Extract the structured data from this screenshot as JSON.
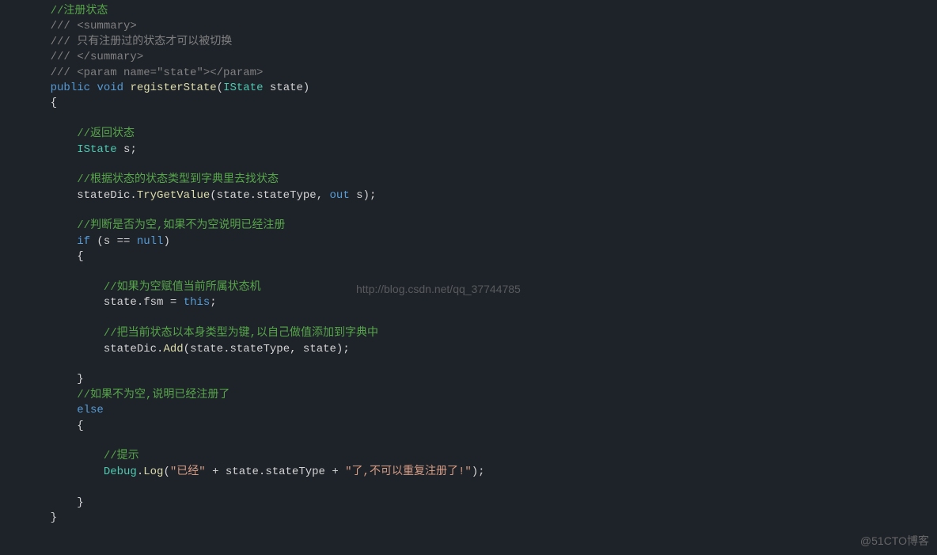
{
  "lines": [
    {
      "indent": 1,
      "tokens": [
        {
          "type": "comment",
          "text": "//注册状态"
        }
      ]
    },
    {
      "indent": 1,
      "tokens": [
        {
          "type": "xml-doc",
          "text": "/// <summary>"
        }
      ]
    },
    {
      "indent": 1,
      "tokens": [
        {
          "type": "xml-doc",
          "text": "/// 只有注册过的状态才可以被切换"
        }
      ]
    },
    {
      "indent": 1,
      "tokens": [
        {
          "type": "xml-doc",
          "text": "/// </summary>"
        }
      ]
    },
    {
      "indent": 1,
      "tokens": [
        {
          "type": "xml-doc",
          "text": "/// <param name=\"state\"></param>"
        }
      ]
    },
    {
      "indent": 1,
      "tokens": [
        {
          "type": "keyword",
          "text": "public"
        },
        {
          "type": "punctuation",
          "text": " "
        },
        {
          "type": "keyword",
          "text": "void"
        },
        {
          "type": "punctuation",
          "text": " "
        },
        {
          "type": "method",
          "text": "registerState"
        },
        {
          "type": "punctuation",
          "text": "("
        },
        {
          "type": "type",
          "text": "IState"
        },
        {
          "type": "punctuation",
          "text": " state)"
        }
      ]
    },
    {
      "indent": 1,
      "tokens": [
        {
          "type": "punctuation",
          "text": "{"
        }
      ]
    },
    {
      "indent": 2,
      "tokens": []
    },
    {
      "indent": 2,
      "tokens": [
        {
          "type": "comment",
          "text": "//返回状态"
        }
      ]
    },
    {
      "indent": 2,
      "tokens": [
        {
          "type": "type",
          "text": "IState"
        },
        {
          "type": "punctuation",
          "text": " s;"
        }
      ]
    },
    {
      "indent": 2,
      "tokens": []
    },
    {
      "indent": 2,
      "tokens": [
        {
          "type": "comment",
          "text": "//根据状态的状态类型到字典里去找状态"
        }
      ]
    },
    {
      "indent": 2,
      "tokens": [
        {
          "type": "identifier",
          "text": "stateDic."
        },
        {
          "type": "method",
          "text": "TryGetValue"
        },
        {
          "type": "punctuation",
          "text": "(state."
        },
        {
          "type": "identifier",
          "text": "stateType"
        },
        {
          "type": "punctuation",
          "text": ", "
        },
        {
          "type": "keyword",
          "text": "out"
        },
        {
          "type": "punctuation",
          "text": " s);"
        }
      ]
    },
    {
      "indent": 2,
      "tokens": []
    },
    {
      "indent": 2,
      "tokens": [
        {
          "type": "comment",
          "text": "//判断是否为空,如果不为空说明已经注册"
        }
      ]
    },
    {
      "indent": 2,
      "tokens": [
        {
          "type": "keyword",
          "text": "if"
        },
        {
          "type": "punctuation",
          "text": " (s == "
        },
        {
          "type": "keyword",
          "text": "null"
        },
        {
          "type": "punctuation",
          "text": ")"
        }
      ]
    },
    {
      "indent": 2,
      "tokens": [
        {
          "type": "punctuation",
          "text": "{"
        }
      ]
    },
    {
      "indent": 4,
      "tokens": []
    },
    {
      "indent": 3,
      "tokens": [
        {
          "type": "comment",
          "text": "//如果为空赋值当前所属状态机"
        }
      ]
    },
    {
      "indent": 3,
      "tokens": [
        {
          "type": "identifier",
          "text": "state."
        },
        {
          "type": "identifier",
          "text": "fsm"
        },
        {
          "type": "punctuation",
          "text": " = "
        },
        {
          "type": "keyword",
          "text": "this"
        },
        {
          "type": "punctuation",
          "text": ";"
        }
      ]
    },
    {
      "indent": 3,
      "tokens": []
    },
    {
      "indent": 3,
      "tokens": [
        {
          "type": "comment",
          "text": "//把当前状态以本身类型为键,以自己做值添加到字典中"
        }
      ]
    },
    {
      "indent": 3,
      "tokens": [
        {
          "type": "identifier",
          "text": "stateDic."
        },
        {
          "type": "method",
          "text": "Add"
        },
        {
          "type": "punctuation",
          "text": "(state."
        },
        {
          "type": "identifier",
          "text": "stateType"
        },
        {
          "type": "punctuation",
          "text": ", state);"
        }
      ]
    },
    {
      "indent": 3,
      "tokens": []
    },
    {
      "indent": 2,
      "tokens": [
        {
          "type": "punctuation",
          "text": "}"
        }
      ]
    },
    {
      "indent": 2,
      "tokens": [
        {
          "type": "comment",
          "text": "//如果不为空,说明已经注册了"
        }
      ]
    },
    {
      "indent": 2,
      "tokens": [
        {
          "type": "keyword",
          "text": "else"
        }
      ]
    },
    {
      "indent": 2,
      "tokens": [
        {
          "type": "punctuation",
          "text": "{"
        }
      ]
    },
    {
      "indent": 4,
      "tokens": []
    },
    {
      "indent": 3,
      "tokens": [
        {
          "type": "comment",
          "text": "//提示"
        }
      ]
    },
    {
      "indent": 3,
      "tokens": [
        {
          "type": "type",
          "text": "Debug"
        },
        {
          "type": "punctuation",
          "text": "."
        },
        {
          "type": "method",
          "text": "Log"
        },
        {
          "type": "punctuation",
          "text": "("
        },
        {
          "type": "string",
          "text": "\"已经\""
        },
        {
          "type": "punctuation",
          "text": " + state."
        },
        {
          "type": "identifier",
          "text": "stateType"
        },
        {
          "type": "punctuation",
          "text": " + "
        },
        {
          "type": "string",
          "text": "\"了,不可以重复注册了!\""
        },
        {
          "type": "punctuation",
          "text": ");"
        }
      ]
    },
    {
      "indent": 3,
      "tokens": []
    },
    {
      "indent": 2,
      "tokens": [
        {
          "type": "punctuation",
          "text": "}"
        }
      ]
    },
    {
      "indent": 1,
      "tokens": [
        {
          "type": "punctuation",
          "text": "}"
        }
      ]
    }
  ],
  "watermark": "http://blog.csdn.net/qq_37744785",
  "copyright": "@51CTO博客"
}
